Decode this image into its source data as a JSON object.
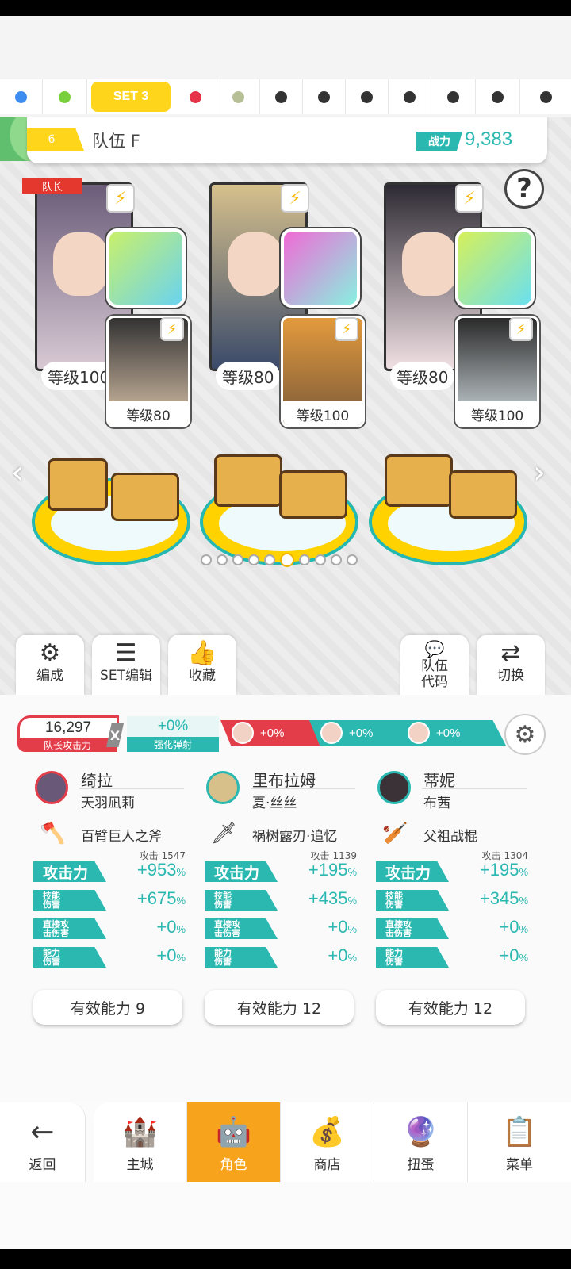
{
  "set_tabs": {
    "active_label": "SET 3",
    "dots": [
      {
        "color": "#3d8cf0"
      },
      {
        "color": "#7ad03c"
      },
      {
        "color": "#e6334a"
      },
      {
        "color": "#b7bf96"
      },
      {
        "color": "#333333"
      },
      {
        "color": "#333333"
      },
      {
        "color": "#333333"
      },
      {
        "color": "#333333"
      },
      {
        "color": "#333333"
      },
      {
        "color": "#333333"
      },
      {
        "color": "#333333"
      }
    ]
  },
  "team": {
    "number": "6",
    "name": "队伍 F",
    "power_label": "战力",
    "power_value": "9,383"
  },
  "help_label": "?",
  "captain_label": "队长",
  "heroes": [
    {
      "level": "等级100",
      "sub_level": "等级80",
      "weapon_colors": [
        "#c9f06a",
        "#6ad3f0"
      ]
    },
    {
      "level": "等级80",
      "sub_level": "等级100",
      "weapon_colors": [
        "#f16ad5",
        "#88f0e0"
      ]
    },
    {
      "level": "等级80",
      "sub_level": "等级100",
      "weapon_colors": [
        "#d6f05a",
        "#6ae0f0"
      ]
    }
  ],
  "actions": {
    "formation": "编成",
    "set_edit": "SET编辑",
    "favorite": "收藏",
    "team_code_1": "队伍",
    "team_code_2": "代码",
    "switch": "切换"
  },
  "leader_attack": {
    "value": "16,297",
    "label": "队长攻击力"
  },
  "multiplier": "X",
  "boost": {
    "value": "+0%",
    "label": "强化弹射"
  },
  "buffs": [
    {
      "value": "+0%",
      "color": "#e33d49"
    },
    {
      "value": "+0%",
      "color": "#2ab8b0"
    },
    {
      "value": "+0%",
      "color": "#2ab8b0"
    }
  ],
  "columns": [
    {
      "name": "绮拉",
      "sub_name": "天羽凪莉",
      "weapon": "百臂巨人之斧",
      "base_attack": "攻击 1547",
      "attack_label": "攻击力",
      "attack": "+953",
      "skill_label_1": "技能",
      "skill_label_2": "伤害",
      "skill": "+675",
      "direct_label_1": "直接攻",
      "direct_label_2": "击伤害",
      "direct": "+0",
      "ability_label_1": "能力",
      "ability_label_2": "伤害",
      "ability": "+0",
      "pct": "%",
      "effective": "有效能力 9"
    },
    {
      "name": "里布拉姆",
      "sub_name": "夏·丝丝",
      "weapon": "祸树露刃·追忆",
      "base_attack": "攻击 1139",
      "attack_label": "攻击力",
      "attack": "+195",
      "skill_label_1": "技能",
      "skill_label_2": "伤害",
      "skill": "+435",
      "direct_label_1": "直接攻",
      "direct_label_2": "击伤害",
      "direct": "+0",
      "ability_label_1": "能力",
      "ability_label_2": "伤害",
      "ability": "+0",
      "pct": "%",
      "effective": "有效能力 12"
    },
    {
      "name": "蒂妮",
      "sub_name": "布茜",
      "weapon": "父祖战棍",
      "base_attack": "攻击 1304",
      "attack_label": "攻击力",
      "attack": "+195",
      "skill_label_1": "技能",
      "skill_label_2": "伤害",
      "skill": "+345",
      "direct_label_1": "直接攻",
      "direct_label_2": "击伤害",
      "direct": "+0",
      "ability_label_1": "能力",
      "ability_label_2": "伤害",
      "ability": "+0",
      "pct": "%",
      "effective": "有效能力 12"
    }
  ],
  "bottom_nav": {
    "back": "返回",
    "city": "主城",
    "hero": "角色",
    "shop": "商店",
    "gacha": "扭蛋",
    "menu": "菜单"
  },
  "colors": {
    "accent_teal": "#2ab8b0",
    "accent_yellow": "#ffd51c",
    "accent_red": "#e33d49",
    "nav_active": "#f7a31c"
  }
}
